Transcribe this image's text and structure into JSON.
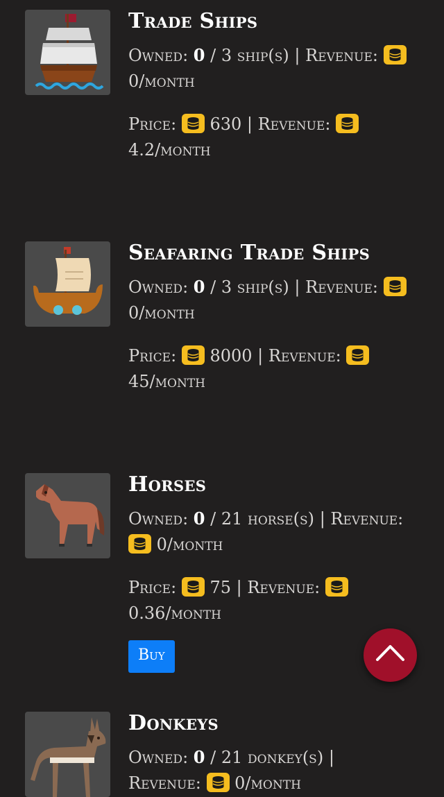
{
  "items": [
    {
      "title": "Trade Ships",
      "owned_label": "Owned:",
      "owned_count": "0",
      "owned_max": "/ 3",
      "unit": "ship(s)",
      "revenue_label": "| Revenue:",
      "owned_revenue": "0/month",
      "price_label": "Price:",
      "price": "630",
      "price_revenue_label": "| Revenue:",
      "revenue_each": "4.2/month",
      "icon": "ship-icon"
    },
    {
      "title": "Seafaring Trade Ships",
      "owned_label": "Owned:",
      "owned_count": "0",
      "owned_max": "/ 3",
      "unit": "ship(s)",
      "revenue_label": "| Revenue:",
      "owned_revenue": "0/month",
      "price_label": "Price:",
      "price": "8000",
      "price_revenue_label": "| Revenue:",
      "revenue_each": "45/month",
      "icon": "viking-ship-icon"
    },
    {
      "title": "Horses",
      "owned_label": "Owned:",
      "owned_count": "0",
      "owned_max": "/ 21",
      "unit": "horse(s)",
      "revenue_label": "| Revenue:",
      "owned_revenue": "0/month",
      "price_label": "Price:",
      "price": "75",
      "price_revenue_label": "| Revenue:",
      "revenue_each": "0.36/month",
      "buy_label": "Buy",
      "icon": "horse-icon"
    },
    {
      "title": "Donkeys",
      "owned_label": "Owned:",
      "owned_count": "0",
      "owned_max": "/ 21",
      "unit": "donkey(s)",
      "revenue_label": "|",
      "revenue_label2": "Revenue:",
      "owned_revenue": "0/month",
      "icon": "donkey-icon"
    }
  ],
  "colors": {
    "background": "#211f1f",
    "coin": "#f5bd1f",
    "buy_button": "#0d7ef8",
    "scroll_button": "#a0102a"
  },
  "scroll_top_icon": "chevron-up-icon"
}
